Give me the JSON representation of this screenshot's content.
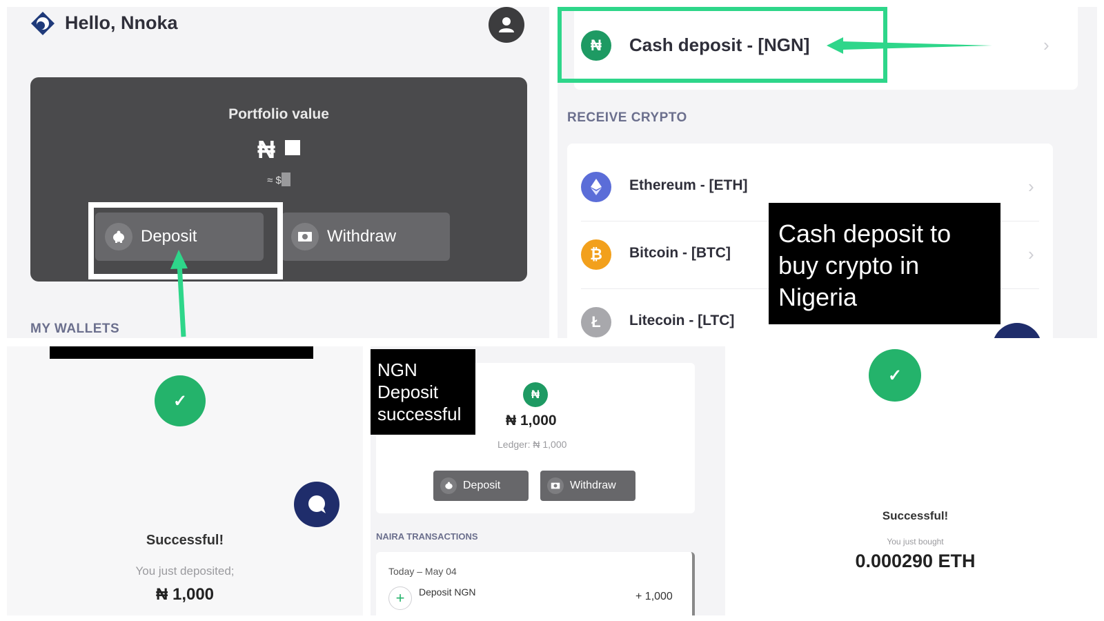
{
  "colors": {
    "green": "#24b36b",
    "highlight_green": "#2ed68a",
    "navy": "#1f2d6b",
    "card_dark": "#4a4a4c"
  },
  "home": {
    "greeting": "Hello, Nnoka",
    "portfolio_label": "Portfolio value",
    "portfolio_symbol": "₦",
    "usd_prefix": "≈ $",
    "deposit_label": "Deposit",
    "withdraw_label": "Withdraw",
    "my_wallets": "MY WALLETS"
  },
  "deposit_options": {
    "cash_deposit": "Cash deposit - [NGN]",
    "receive_crypto": "RECEIVE CRYPTO",
    "coins": [
      {
        "name": "Ethereum - [ETH]",
        "icon": "ethereum-icon"
      },
      {
        "name": "Bitcoin - [BTC]",
        "icon": "bitcoin-icon"
      },
      {
        "name": "Litecoin - [LTC]",
        "icon": "litecoin-icon"
      }
    ],
    "note": "Cash deposit to buy crypto in Nigeria"
  },
  "deposit_success": {
    "title": "Successful!",
    "subtitle": "You just deposited;",
    "amount": "₦ 1,000"
  },
  "wallet": {
    "note": "NGN Deposit successful",
    "currency_symbol": "₦",
    "balance": "₦ 1,000",
    "ledger": "Ledger: ₦ 1,000",
    "deposit_label": "Deposit",
    "withdraw_label": "Withdraw",
    "transactions_header": "NAIRA TRANSACTIONS",
    "tx_date": "Today – May 04",
    "tx_title": "Deposit NGN",
    "tx_amount": "+ 1,000"
  },
  "buy_success": {
    "title": "Successful!",
    "subtitle": "You just bought",
    "amount": "0.000290 ETH"
  }
}
